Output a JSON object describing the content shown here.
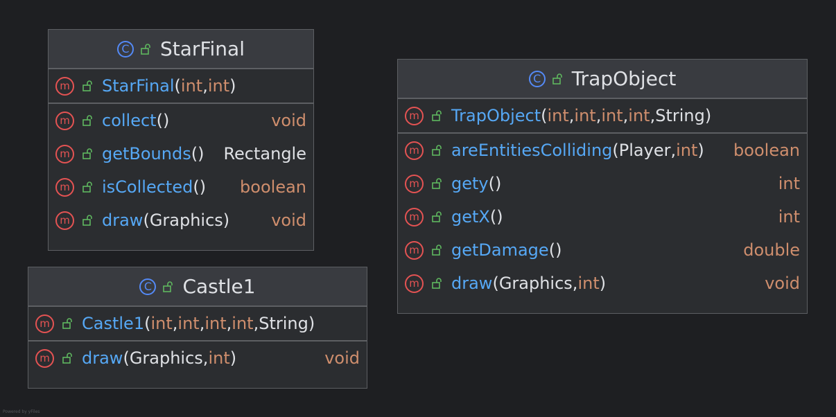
{
  "diagram": {
    "classes": [
      {
        "id": "starfinal",
        "name": "StarFinal",
        "constructors": [
          {
            "name": "StarFinal",
            "params": [
              {
                "t": "int",
                "p": true
              },
              {
                "t": "int",
                "p": true
              }
            ],
            "ret": ""
          }
        ],
        "methods": [
          {
            "name": "collect",
            "params": [],
            "ret": "void",
            "ret_prim": true
          },
          {
            "name": "getBounds",
            "params": [],
            "ret": "Rectangle",
            "ret_prim": false
          },
          {
            "name": "isCollected",
            "params": [],
            "ret": "boolean",
            "ret_prim": true
          },
          {
            "name": "draw",
            "params": [
              {
                "t": "Graphics",
                "p": false
              }
            ],
            "ret": "void",
            "ret_prim": true
          }
        ]
      },
      {
        "id": "castle1",
        "name": "Castle1",
        "constructors": [
          {
            "name": "Castle1",
            "params": [
              {
                "t": "int",
                "p": true
              },
              {
                "t": "int",
                "p": true
              },
              {
                "t": "int",
                "p": true
              },
              {
                "t": "int",
                "p": true
              },
              {
                "t": "String",
                "p": false
              }
            ],
            "ret": ""
          }
        ],
        "methods": [
          {
            "name": "draw",
            "params": [
              {
                "t": "Graphics",
                "p": false
              },
              {
                "t": "int",
                "p": true
              }
            ],
            "ret": "void",
            "ret_prim": true
          }
        ]
      },
      {
        "id": "trapobject",
        "name": "TrapObject",
        "constructors": [
          {
            "name": "TrapObject",
            "params": [
              {
                "t": "int",
                "p": true
              },
              {
                "t": "int",
                "p": true
              },
              {
                "t": "int",
                "p": true
              },
              {
                "t": "int",
                "p": true
              },
              {
                "t": "String",
                "p": false
              }
            ],
            "ret": ""
          }
        ],
        "methods": [
          {
            "name": "areEntitiesColliding",
            "params": [
              {
                "t": "Player",
                "p": false
              },
              {
                "t": "int",
                "p": true
              }
            ],
            "ret": "boolean",
            "ret_prim": true
          },
          {
            "name": "gety",
            "params": [],
            "ret": "int",
            "ret_prim": true
          },
          {
            "name": "getX",
            "params": [],
            "ret": "int",
            "ret_prim": true
          },
          {
            "name": "getDamage",
            "params": [],
            "ret": "double",
            "ret_prim": true
          },
          {
            "name": "draw",
            "params": [
              {
                "t": "Graphics",
                "p": false
              },
              {
                "t": "int",
                "p": true
              }
            ],
            "ret": "void",
            "ret_prim": true
          }
        ]
      }
    ],
    "class_icon_letter": "C",
    "method_icon_letter": "m",
    "icons": {
      "class": "class-icon",
      "method": "method-icon",
      "visibility": "public-lock-icon"
    },
    "colors": {
      "background": "#1e1f22",
      "method_name": "#56a8f5",
      "primitive": "#cf8e6d",
      "text": "#dfe1e5",
      "class_icon": "#548af7",
      "method_icon": "#e55353",
      "lock": "#5fb85f"
    }
  },
  "footer": {
    "text": "Powered by yFiles"
  }
}
